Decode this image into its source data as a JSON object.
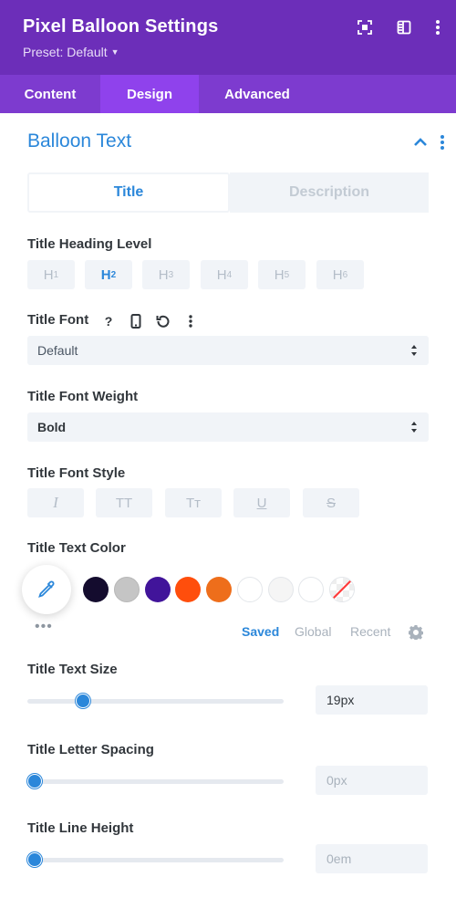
{
  "header": {
    "title": "Pixel Balloon Settings",
    "preset": "Preset: Default",
    "icons": [
      "focus-icon",
      "sidebar-layout-icon",
      "more-vertical-icon"
    ],
    "bg_color": "#6c2eb9"
  },
  "tabs": [
    {
      "label": "Content",
      "active": false
    },
    {
      "label": "Design",
      "active": true
    },
    {
      "label": "Advanced",
      "active": false
    }
  ],
  "section": {
    "title": "Balloon Text"
  },
  "subtabs": [
    {
      "label": "Title",
      "active": true
    },
    {
      "label": "Description",
      "active": false
    }
  ],
  "heading_level": {
    "label": "Title Heading Level",
    "options": [
      {
        "base": "H",
        "sub": "1"
      },
      {
        "base": "H",
        "sub": "2"
      },
      {
        "base": "H",
        "sub": "3"
      },
      {
        "base": "H",
        "sub": "4"
      },
      {
        "base": "H",
        "sub": "5"
      },
      {
        "base": "H",
        "sub": "6"
      }
    ],
    "selected_index": 1
  },
  "font": {
    "label": "Title Font",
    "icons": [
      "help-icon",
      "mobile-icon",
      "reset-icon",
      "more-vertical-icon"
    ],
    "help_glyph": "?",
    "value": "Default"
  },
  "font_weight": {
    "label": "Title Font Weight",
    "value": "Bold"
  },
  "font_style": {
    "label": "Title Font Style",
    "options": [
      "I",
      "TT",
      "Tт",
      "U",
      "S"
    ]
  },
  "text_color": {
    "label": "Title Text Color",
    "swatches": [
      "#140c2e",
      "#c5c5c5",
      "#41149a",
      "#ff4e0c",
      "#ee6e1b",
      "#ffffff",
      "#f5f5f5",
      "#ffffff",
      "none"
    ],
    "more": "•••",
    "saved": "Saved",
    "global": "Global",
    "recent": "Recent"
  },
  "text_size": {
    "label": "Title Text Size",
    "value": "19px",
    "fraction": 0.2
  },
  "letter_spacing": {
    "label": "Title Letter Spacing",
    "value": "0px",
    "fraction": 0
  },
  "line_height": {
    "label": "Title Line Height",
    "value": "0em",
    "fraction": 0
  }
}
